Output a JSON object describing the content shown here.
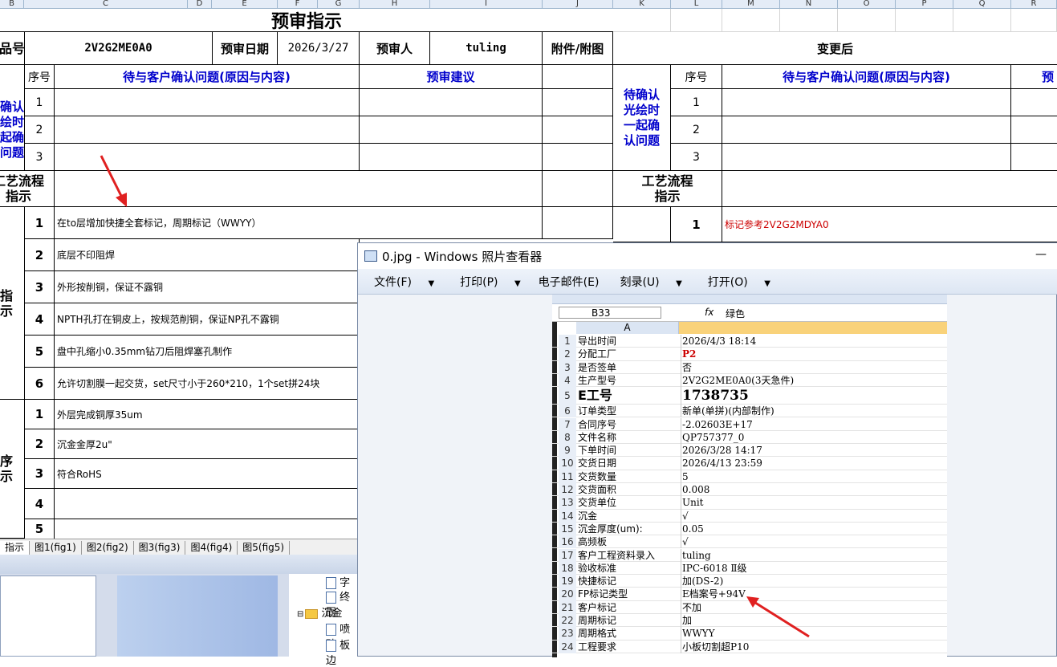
{
  "colors": {
    "blue_text": "#0000cc",
    "red_text": "#cc0000",
    "arrow": "#e02020"
  },
  "sheet": {
    "col_letters": [
      "B",
      "C",
      "D",
      "E",
      "F",
      "G",
      "H",
      "I",
      "J",
      "K",
      "L",
      "M",
      "N",
      "O",
      "P",
      "Q",
      "R"
    ],
    "title": "预审指示",
    "row1": {
      "left_label": "品号",
      "part_no": "2V2G2ME0A0",
      "date_label": "预审日期",
      "date": "2026/3/27",
      "reviewer_label": "预审人",
      "reviewer": "tuling",
      "attach_label": "附件/附图",
      "after_label": "变更后"
    },
    "hdr": {
      "seq": "序号",
      "issue": "待与客户确认问题(原因与内容)",
      "suggest": "预审建议",
      "seq2": "序号",
      "issue2": "待与客户确认问题(原因与内容)",
      "suggest2": "预"
    },
    "left_group1": "确认\n绘时\n起确\n问题",
    "right_group1": "待确认\n光绘时\n一起确\n认问题",
    "confirm_rows": [
      "1",
      "2",
      "3"
    ],
    "process_label": "工艺流程\n指示",
    "process_label_left": "工艺流程\n指示",
    "right_process_row": {
      "num": "1",
      "text": "标记参考2V2G2MDYA0"
    },
    "left_group2": "指\n示",
    "instructions": [
      {
        "num": "1",
        "text": "在to层增加快捷全套标记，周期标记（WWYY）"
      },
      {
        "num": "2",
        "text": "底层不印阻焊"
      },
      {
        "num": "3",
        "text": "外形按削铜，保证不露铜"
      },
      {
        "num": "4",
        "text": "NPTH孔打在铜皮上，按规范削铜，保证NP孔不露铜"
      },
      {
        "num": "5",
        "text": "盘中孔缩小0.35mm钻刀后阻焊塞孔制作"
      },
      {
        "num": "6",
        "text": "允许切割膜一起交货，set尺寸小于260*210，1个set拼24块"
      }
    ],
    "left_group3": "序\n示",
    "requirements": [
      {
        "num": "1",
        "text": "外层完成铜厚35um"
      },
      {
        "num": "2",
        "text": "沉金金厚2u\""
      },
      {
        "num": "3",
        "text": "符合RoHS"
      },
      {
        "num": "4",
        "text": ""
      },
      {
        "num": "5",
        "text": ""
      }
    ],
    "tabs": [
      "指示",
      "图1(fig1)",
      "图2(fig2)",
      "图3(fig3)",
      "图4(fig4)",
      "图5(fig5)"
    ]
  },
  "tree": {
    "items": [
      "字符",
      "终固",
      "沉金",
      "喷砂",
      "板边"
    ]
  },
  "viewer": {
    "title": "0.jpg - Windows 照片查看器",
    "minimize": "—",
    "menu": [
      "文件(F)",
      "打印(P)",
      "电子邮件(E)",
      "刻录(U)",
      "打开(O)"
    ],
    "photo": {
      "name_box": "B33",
      "fx": "fx",
      "formula": "绿色",
      "col_a": "A",
      "rows": [
        {
          "n": "1",
          "a": "导出时间",
          "b": "2026/4/3 18:14"
        },
        {
          "n": "2",
          "a": "分配工厂",
          "b": "P2"
        },
        {
          "n": "3",
          "a": "是否签单",
          "b": "否"
        },
        {
          "n": "4",
          "a": "生产型号",
          "b": "2V2G2ME0A0(3天急件)"
        },
        {
          "n": "5",
          "a": "E工号",
          "b": "1738735"
        },
        {
          "n": "6",
          "a": "订单类型",
          "b": "新单(单拼)(内部制作)"
        },
        {
          "n": "7",
          "a": "合同序号",
          "b": "-2.02603E+17"
        },
        {
          "n": "8",
          "a": "文件名称",
          "b": "QP757377_0"
        },
        {
          "n": "9",
          "a": "下单时间",
          "b": "2026/3/28 14:17"
        },
        {
          "n": "10",
          "a": "交货日期",
          "b": "2026/4/13 23:59"
        },
        {
          "n": "11",
          "a": "交货数量",
          "b": "5"
        },
        {
          "n": "12",
          "a": "交货面积",
          "b": "0.008"
        },
        {
          "n": "13",
          "a": "交货单位",
          "b": "Unit"
        },
        {
          "n": "14",
          "a": "沉金",
          "b": "√"
        },
        {
          "n": "15",
          "a": "沉金厚度(um):",
          "b": "0.05"
        },
        {
          "n": "16",
          "a": "高频板",
          "b": "√"
        },
        {
          "n": "17",
          "a": "客户工程资料录入",
          "b": "tuling"
        },
        {
          "n": "18",
          "a": "验收标准",
          "b": "IPC-6018 Ⅱ级"
        },
        {
          "n": "19",
          "a": "快捷标记",
          "b": "加(DS-2)"
        },
        {
          "n": "20",
          "a": "FP标记类型",
          "b": "E档案号+94V"
        },
        {
          "n": "21",
          "a": "客户标记",
          "b": "不加"
        },
        {
          "n": "22",
          "a": "周期标记",
          "b": "加"
        },
        {
          "n": "23",
          "a": "周期格式",
          "b": "WWYY"
        },
        {
          "n": "24",
          "a": "工程要求",
          "b": "小板切割超P10"
        }
      ]
    }
  }
}
